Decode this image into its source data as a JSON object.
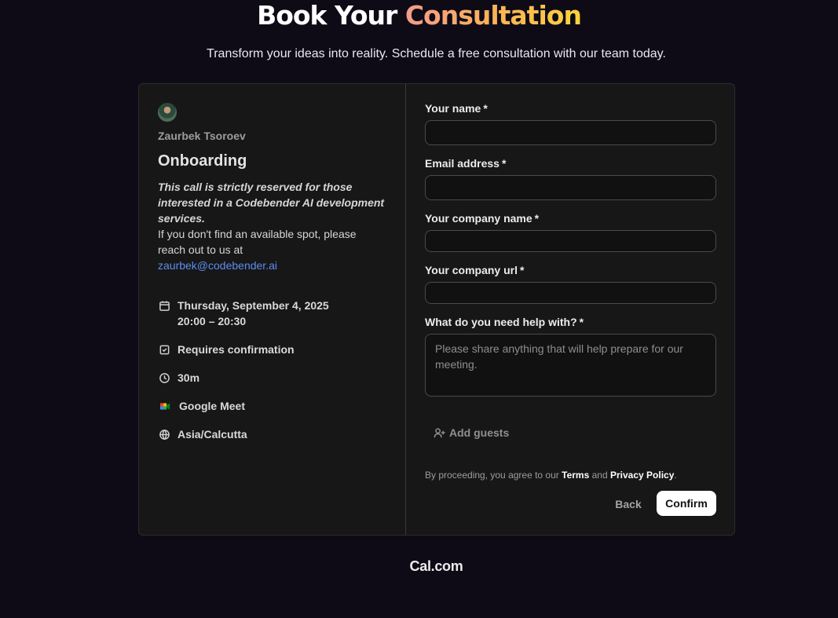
{
  "hero": {
    "title_plain": "Book Your",
    "title_accent": "Consultation",
    "subtitle": "Transform your ideas into reality. Schedule a free consultation with our team today."
  },
  "event": {
    "host_name": "Zaurbek Tsoroev",
    "title": "Onboarding",
    "description_emphasis": "This call is strictly reserved for those interested in a Codebender AI development services.",
    "description_text": "If you don't find an available spot, please reach out to us at",
    "contact_email": "zaurbek@codebender.ai",
    "date": "Thursday, September 4, 2025",
    "time_range": "20:00 – 20:30",
    "confirmation": "Requires confirmation",
    "duration": "30m",
    "location": "Google Meet",
    "timezone": "Asia/Calcutta"
  },
  "form": {
    "name_label": "Your name",
    "email_label": "Email address",
    "company_label": "Your company name",
    "company_url_label": "Your company url",
    "help_label": "What do you need help with?",
    "help_placeholder": "Please share anything that will help prepare for our meeting.",
    "required_mark": "*",
    "add_guests": "Add guests",
    "terms_prefix": "By proceeding, you agree to our",
    "terms_link": "Terms",
    "terms_and": "and",
    "privacy_link": "Privacy Policy",
    "terms_suffix": ".",
    "back": "Back",
    "confirm": "Confirm"
  },
  "footer": {
    "brand": "Cal.com"
  },
  "colors": {
    "background": "#0e0b17",
    "card": "#171717",
    "link": "#5b8def",
    "accent_gradient_start": "#f39c8a",
    "accent_gradient_end": "#fdd33c"
  },
  "icons": {
    "date": "calendar-icon",
    "confirmation": "checkbox-icon",
    "duration": "clock-icon",
    "location": "google-meet-icon",
    "timezone": "globe-icon",
    "add_guests": "user-plus-icon"
  }
}
